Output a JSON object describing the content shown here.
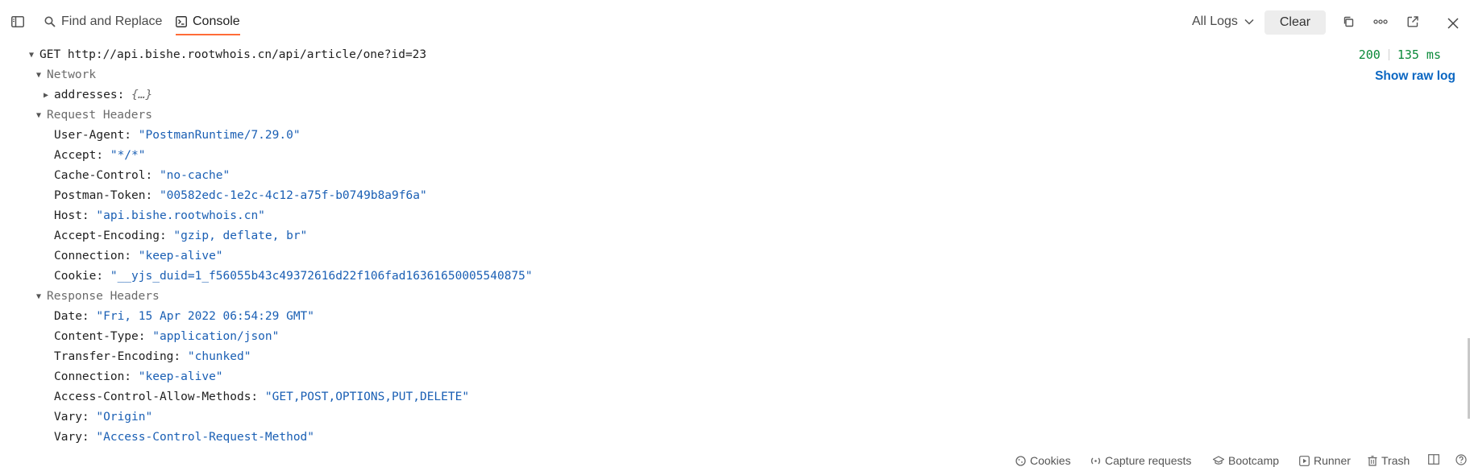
{
  "topbar": {
    "tabs": [
      {
        "label": "Find and Replace",
        "icon": "search-icon"
      },
      {
        "label": "Console",
        "icon": "console-icon",
        "active": true
      }
    ],
    "log_filter": "All Logs",
    "clear_label": "Clear"
  },
  "request": {
    "line": "GET http://api.bishe.rootwhois.cn/api/article/one?id=23",
    "status": "200",
    "time": "135 ms",
    "raw_link": "Show raw log"
  },
  "sections": {
    "network": {
      "title": "Network",
      "items": [
        {
          "key": "addresses:",
          "value": "{…}"
        }
      ]
    },
    "request_headers": {
      "title": "Request Headers",
      "items": [
        {
          "key": "User-Agent:",
          "value": "\"PostmanRuntime/7.29.0\""
        },
        {
          "key": "Accept:",
          "value": "\"*/*\""
        },
        {
          "key": "Cache-Control:",
          "value": "\"no-cache\""
        },
        {
          "key": "Postman-Token:",
          "value": "\"00582edc-1e2c-4c12-a75f-b0749b8a9f6a\""
        },
        {
          "key": "Host:",
          "value": "\"api.bishe.rootwhois.cn\""
        },
        {
          "key": "Accept-Encoding:",
          "value": "\"gzip, deflate, br\""
        },
        {
          "key": "Connection:",
          "value": "\"keep-alive\""
        },
        {
          "key": "Cookie:",
          "value": "\"__yjs_duid=1_f56055b43c49372616d22f106fad16361650005540875\""
        }
      ]
    },
    "response_headers": {
      "title": "Response Headers",
      "items": [
        {
          "key": "Date:",
          "value": "\"Fri, 15 Apr 2022 06:54:29 GMT\""
        },
        {
          "key": "Content-Type:",
          "value": "\"application/json\""
        },
        {
          "key": "Transfer-Encoding:",
          "value": "\"chunked\""
        },
        {
          "key": "Connection:",
          "value": "\"keep-alive\""
        },
        {
          "key": "Access-Control-Allow-Methods:",
          "value": "\"GET,POST,OPTIONS,PUT,DELETE\""
        },
        {
          "key": "Vary:",
          "value": "\"Origin\""
        },
        {
          "key": "Vary:",
          "value": "\"Access-Control-Request-Method\""
        }
      ]
    }
  },
  "statusbar": {
    "items": [
      {
        "label": "Cookies",
        "icon": "cookie-icon"
      },
      {
        "label": "Capture requests",
        "icon": "antenna-icon"
      },
      {
        "label": "Bootcamp",
        "icon": "graduation-cap-icon"
      },
      {
        "label": "Runner",
        "icon": "play-icon"
      },
      {
        "label": "Trash",
        "icon": "trash-icon"
      }
    ]
  },
  "colors": {
    "accent": "#ff6c37",
    "string": "#1a5fb4",
    "status_ok": "#0b8a3a",
    "link": "#0a66c2"
  }
}
